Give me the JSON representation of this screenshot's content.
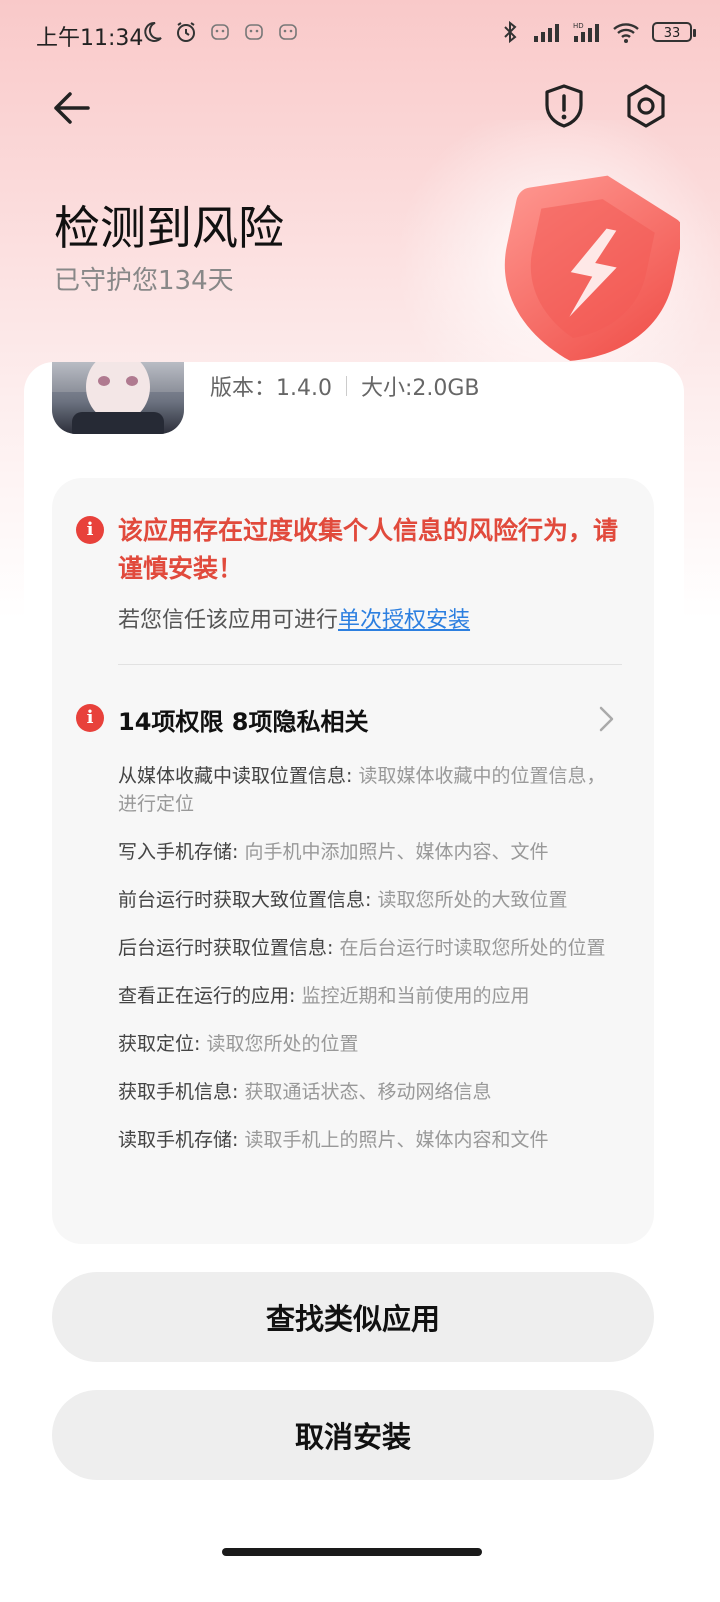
{
  "status_bar": {
    "time": "上午11:34",
    "battery": "33",
    "icons": [
      "moon-icon",
      "alarm-icon",
      "notification-icon",
      "bluetooth-icon",
      "signal-icon",
      "hd-signal-icon",
      "wifi-icon",
      "battery-icon"
    ]
  },
  "header": {
    "title": "检测到风险",
    "subtitle": "已守护您134天"
  },
  "app": {
    "version": "版本：1.4.0",
    "size": "大小:2.0GB"
  },
  "risk": {
    "warning": "该应用存在过度收集个人信息的风险行为，请谨慎安装！",
    "trust_prefix": "若您信任该应用可进行",
    "trust_link": "单次授权安装",
    "permissions_summary": "14项权限 8项隐私相关",
    "permissions": [
      {
        "name": "从媒体收藏中读取位置信息:",
        "desc": " 读取媒体收藏中的位置信息，进行定位"
      },
      {
        "name": "写入手机存储:",
        "desc": " 向手机中添加照片、媒体内容、文件"
      },
      {
        "name": "前台运行时获取大致位置信息:",
        "desc": " 读取您所处的大致位置"
      },
      {
        "name": "后台运行时获取位置信息:",
        "desc": " 在后台运行时读取您所处的位置"
      },
      {
        "name": "查看正在运行的应用:",
        "desc": " 监控近期和当前使用的应用"
      },
      {
        "name": "获取定位:",
        "desc": " 读取您所处的位置"
      },
      {
        "name": "获取手机信息:",
        "desc": " 获取通话状态、移动网络信息"
      },
      {
        "name": "读取手机存储:",
        "desc": " 读取手机上的照片、媒体内容和文件"
      }
    ]
  },
  "actions": {
    "find_similar": "查找类似应用",
    "cancel_install": "取消安装"
  },
  "colors": {
    "warning_red": "#e14a3c",
    "link_blue": "#2c7fe0",
    "header_pink": "#f9c9c9"
  }
}
